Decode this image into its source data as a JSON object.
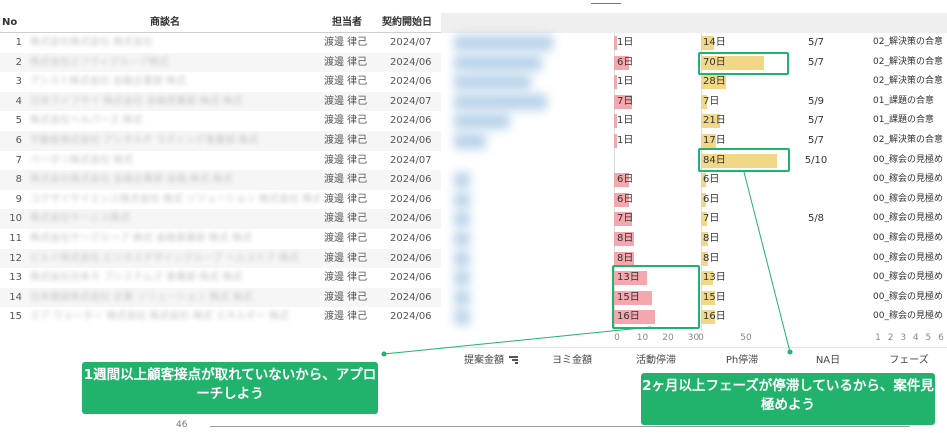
{
  "headers": {
    "no": "No",
    "name": "商談名",
    "owner": "担当者",
    "start_date": "契約開始日"
  },
  "rows": [
    {
      "no": "1",
      "name": "株式会社株式会社 株式会社",
      "owner": "渡邊 律己",
      "date": "2024/07",
      "activity": "1日",
      "activity_days": 1,
      "ph": "14日",
      "ph_days": 14,
      "na": "5/7",
      "phase": "02_解決策の合意"
    },
    {
      "no": "2",
      "name": "株式会社エフティグループ株式",
      "owner": "渡邊 律己",
      "date": "2024/06",
      "activity": "6日",
      "activity_days": 6,
      "ph": "70日",
      "ph_days": 70,
      "na": "5/7",
      "phase": "02_解決策の合意"
    },
    {
      "no": "3",
      "name": "アシスト株式会社 金融企業部 株式",
      "owner": "渡邊 律己",
      "date": "2024/06",
      "activity": "1日",
      "activity_days": 1,
      "ph": "28日",
      "ph_days": 28,
      "na": "",
      "phase": "02_解決策の合意"
    },
    {
      "no": "4",
      "name": "日本ライフサイ 株式会社 金融営業部 株式 株式",
      "owner": "渡邊 律己",
      "date": "2024/07",
      "activity": "7日",
      "activity_days": 7,
      "ph": "7日",
      "ph_days": 7,
      "na": "5/9",
      "phase": "01_課題の合意"
    },
    {
      "no": "5",
      "name": "株式会社ヘルパーズ 株式",
      "owner": "渡邊 律己",
      "date": "2024/06",
      "activity": "1日",
      "activity_days": 1,
      "ph": "21日",
      "ph_days": 21,
      "na": "5/7",
      "phase": "01_課題の合意"
    },
    {
      "no": "6",
      "name": "不動産株式会社 アシタルチ ラディング事業部 株式",
      "owner": "渡邊 律己",
      "date": "2024/06",
      "activity": "1日",
      "activity_days": 1,
      "ph": "17日",
      "ph_days": 17,
      "na": "5/7",
      "phase": "02_解決策の合意"
    },
    {
      "no": "7",
      "name": "ベーボリ株式会社 株式",
      "owner": "渡邊 律己",
      "date": "2024/07",
      "activity": "",
      "activity_days": 0,
      "ph": "84日",
      "ph_days": 84,
      "na": "5/10",
      "phase": "00_稼会の見極め"
    },
    {
      "no": "8",
      "name": "株式会社株式会社 金融企業部 金融 株式 株式",
      "owner": "渡邊 律己",
      "date": "2024/06",
      "activity": "6日",
      "activity_days": 6,
      "ph": "6日",
      "ph_days": 6,
      "na": "",
      "phase": "00_稼会の見極め"
    },
    {
      "no": "9",
      "name": "コクサイサイエンス株式会社 株式 ソリューション 株式会社 株式",
      "owner": "渡邊 律己",
      "date": "2024/06",
      "activity": "6日",
      "activity_days": 6,
      "ph": "6日",
      "ph_days": 6,
      "na": "",
      "phase": "00_稼会の見極め"
    },
    {
      "no": "10",
      "name": "株式会社サービス株式",
      "owner": "渡邊 律己",
      "date": "2024/06",
      "activity": "7日",
      "activity_days": 7,
      "ph": "7日",
      "ph_days": 7,
      "na": "5/8",
      "phase": "00_稼会の見極め"
    },
    {
      "no": "11",
      "name": "株式会社サーグループ 株式 金融事業部 株式 株式",
      "owner": "渡邊 律己",
      "date": "2024/06",
      "activity": "8日",
      "activity_days": 8,
      "ph": "8日",
      "ph_days": 8,
      "na": "",
      "phase": "00_稼会の見極め"
    },
    {
      "no": "12",
      "name": "ビルド株式会社 ビジネスデザイングループ ヘルスケア 株式",
      "owner": "渡邊 律己",
      "date": "2024/06",
      "activity": "8日",
      "activity_days": 8,
      "ph": "8日",
      "ph_days": 8,
      "na": "",
      "phase": "00_稼会の見極め"
    },
    {
      "no": "13",
      "name": "株式会社日本ネ プシステムズ 事業部 株式 株式",
      "owner": "渡邊 律己",
      "date": "2024/06",
      "activity": "13日",
      "activity_days": 13,
      "ph": "13日",
      "ph_days": 13,
      "na": "",
      "phase": "00_稼会の見極め"
    },
    {
      "no": "14",
      "name": "日本建設株式会社 企業 ソリューション 株式 株式",
      "owner": "渡邊 律己",
      "date": "2024/06",
      "activity": "15日",
      "activity_days": 15,
      "ph": "15日",
      "ph_days": 15,
      "na": "",
      "phase": "00_稼会の見極め"
    },
    {
      "no": "15",
      "name": "エア ウォーター 株式会社 株式会社 株式 エネルギー 株式",
      "owner": "渡邊 律己",
      "date": "2024/06",
      "activity": "16日",
      "activity_days": 16,
      "ph": "16日",
      "ph_days": 16,
      "na": "",
      "phase": "00_稼会の見極め"
    }
  ],
  "proposal_amounts": [
    0.62,
    0.55,
    0.48,
    0.58,
    0.35,
    0.2,
    0.0,
    0.1,
    0.1,
    0.1,
    0.1,
    0.1,
    0.1,
    0.1,
    0.1
  ],
  "activity_axis": {
    "ticks": [
      "0",
      "10",
      "20",
      "30"
    ],
    "max": 30
  },
  "ph_axis": {
    "ticks": [
      "0",
      "50"
    ],
    "max": 100
  },
  "phase_axis": {
    "ticks": [
      "1",
      "2",
      "3",
      "4",
      "5",
      "6"
    ]
  },
  "footer": {
    "proposal": "提案金額",
    "yomi": "ヨミ金額",
    "activity": "活動停滞",
    "ph": "Ph停滞",
    "na": "NA日",
    "phase": "フェーズ"
  },
  "callouts": {
    "left": "1週間以上顧客接点が取れていないから、アプローチしよう",
    "right": "2ヶ月以上フェーズが停滞しているから、案件見極めよう"
  },
  "page_number": "46",
  "colors": {
    "accent_green": "#21b36b",
    "activity_bar": "#f4a7ad",
    "ph_bar": "#f2d787"
  }
}
